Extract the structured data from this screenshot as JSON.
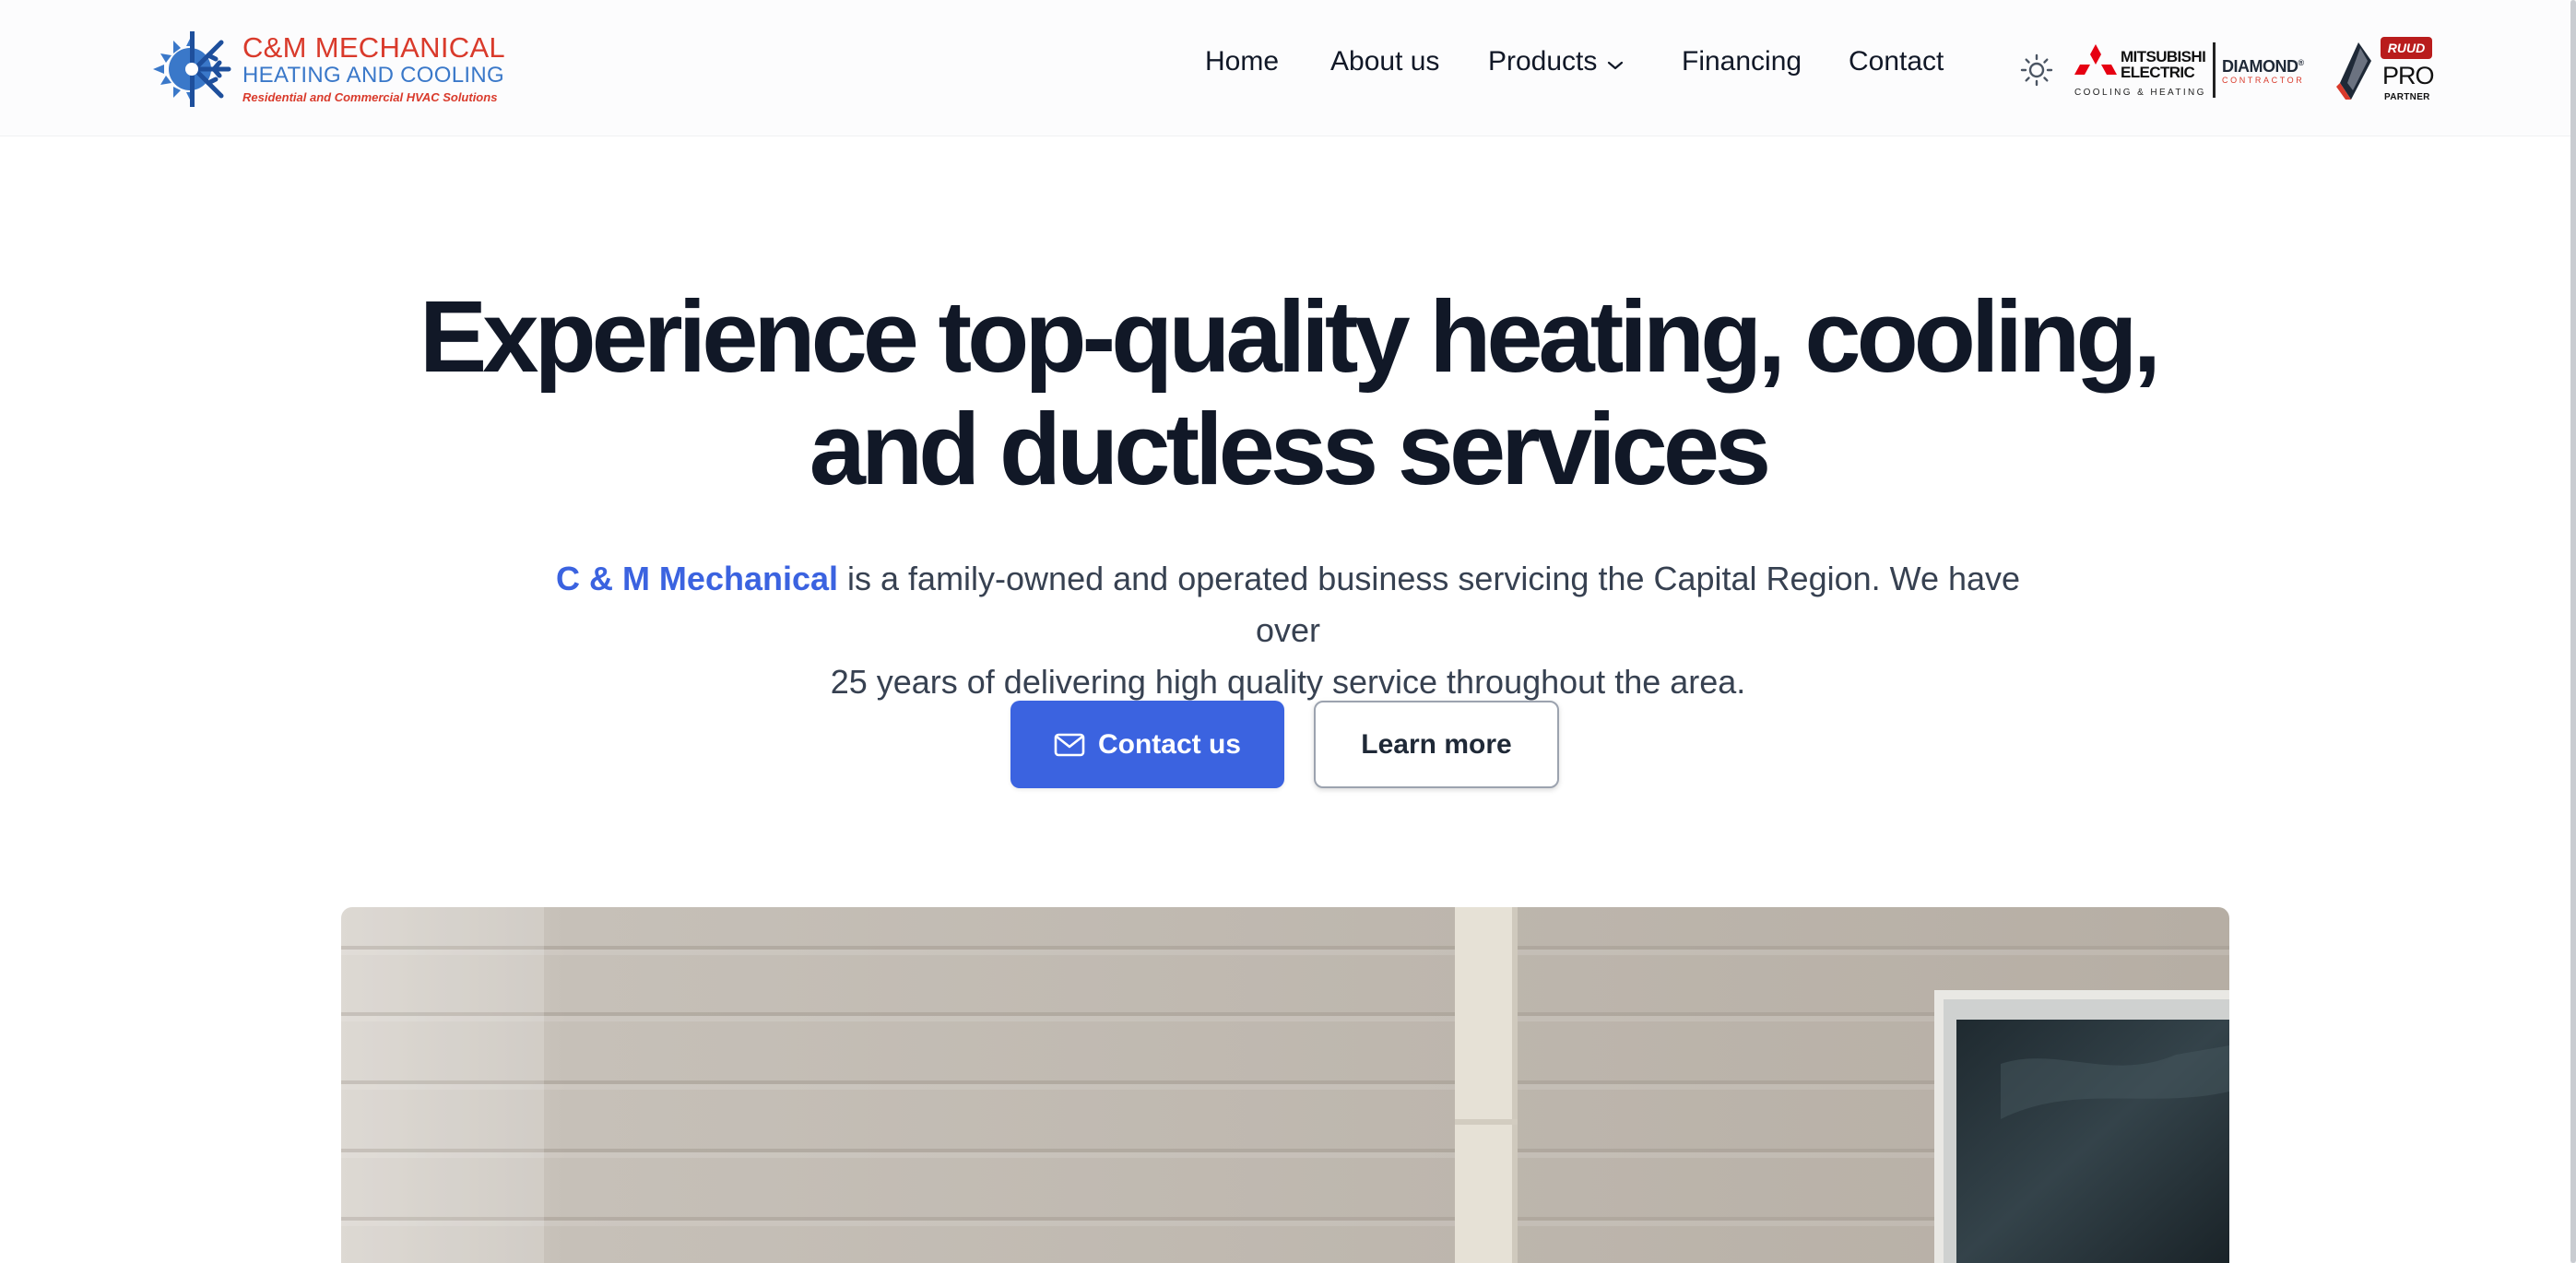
{
  "brand": {
    "line1": "C&M MECHANICAL",
    "line2": "HEATING AND COOLING",
    "tagline": "Residential and Commercial HVAC Solutions",
    "icon": "snowflake-sun-logo-icon"
  },
  "nav": {
    "items": [
      {
        "label": "Home"
      },
      {
        "label": "About us"
      },
      {
        "label": "Products",
        "icon": "chevron-down-icon"
      },
      {
        "label": "Financing"
      },
      {
        "label": "Contact"
      }
    ],
    "theme_icon": "sun-icon"
  },
  "partners": {
    "mitsubishi_line1": "MITSUBISHI",
    "mitsubishi_line2": "ELECTRIC",
    "mitsubishi_sub": "COOLING & HEATING",
    "diamond": "DIAMOND",
    "diamond_mark": "®",
    "diamond_sub": "CONTRACTOR",
    "ruud": "RUUD",
    "pro": "PRO",
    "partner": "PARTNER"
  },
  "hero": {
    "title_line1": "Experience top-quality heating, cooling,",
    "title_line2": "and ductless services",
    "sub_accent": "C & M Mechanical",
    "sub_line1_rest": " is a family-owned and operated business servicing the Capital Region. We have over",
    "sub_line2": "25 years of delivering high quality service throughout the area.",
    "contact_label": "Contact us",
    "contact_icon": "mail-icon",
    "learn_label": "Learn more"
  },
  "colors": {
    "accent": "#3b63e0",
    "text": "#111827",
    "muted": "#374151",
    "brand_red": "#d93a2b",
    "brand_blue": "#3a78c9"
  }
}
